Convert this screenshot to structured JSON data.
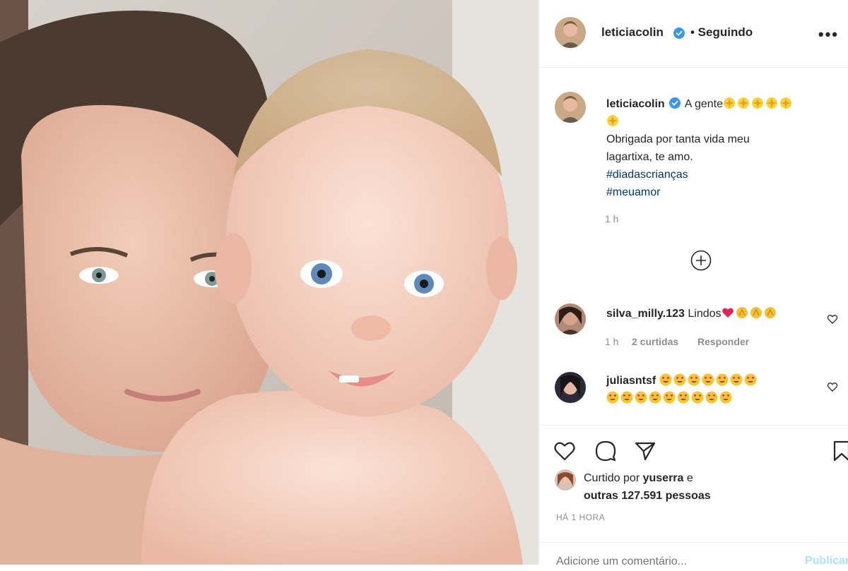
{
  "post": {
    "author": "leticiacolin",
    "follow_status": "• Seguindo",
    "more_icon": "more-dots-icon"
  },
  "caption": {
    "username": "leticiacolin",
    "text_start": "A gente",
    "line2": "Obrigada por tanta vida meu",
    "line3": "lagartixa, te amo.",
    "hashtag1": "#diadascrianças",
    "hashtag2": "#meuamor",
    "time": "1 h"
  },
  "comments": [
    {
      "username": "silva_milly.123",
      "text": "Lindos",
      "time": "1 h",
      "likes": "2 curtidas",
      "reply": "Responder"
    },
    {
      "username": "juliasntsf",
      "text": ""
    }
  ],
  "likes": {
    "prefix": "Curtido por",
    "user": "yuserra",
    "and": "e",
    "others": "outras 127.591 pessoas"
  },
  "timestamp": "HÁ 1 HORA",
  "add_comment": {
    "placeholder": "Adicione um comentário...",
    "publish": "Publicar"
  },
  "colors": {
    "text": "#262626",
    "muted": "#8e8e8e",
    "link": "#00376b",
    "verified": "#3897f0",
    "publish": "#b2dffc"
  }
}
